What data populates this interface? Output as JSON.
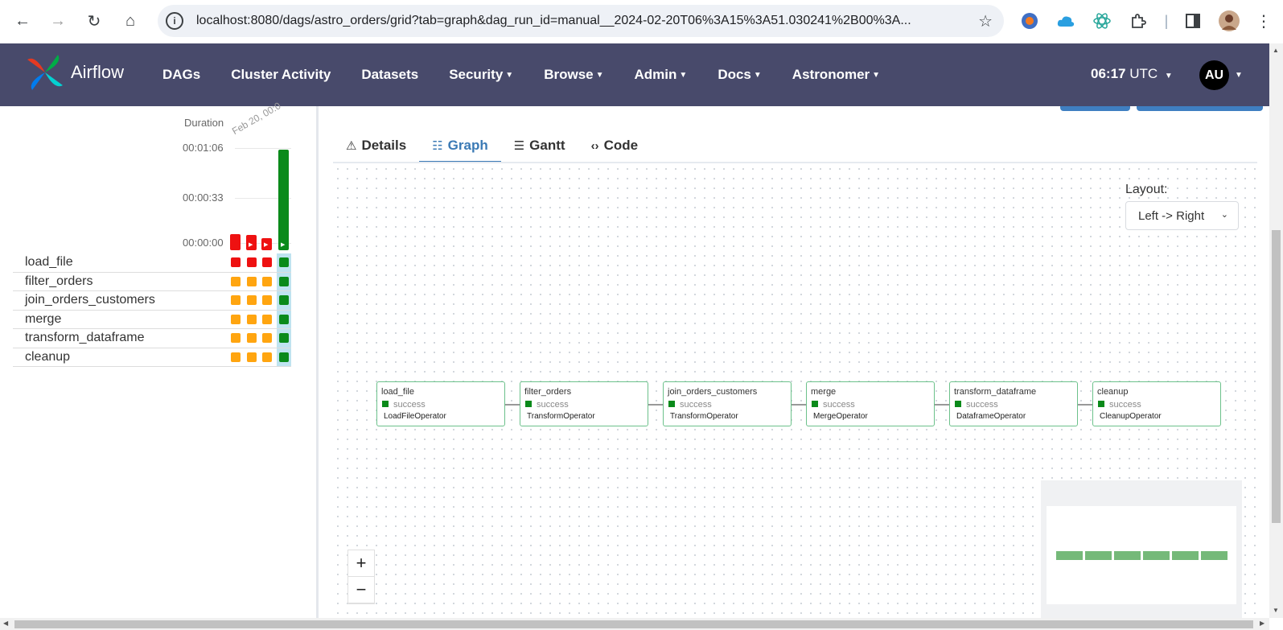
{
  "browser": {
    "url": "localhost:8080/dags/astro_orders/grid?tab=graph&dag_run_id=manual__2024-02-20T06%3A15%3A51.030241%2B00%3A..."
  },
  "navbar": {
    "brand": "Airflow",
    "menu": [
      {
        "label": "DAGs",
        "dropdown": false
      },
      {
        "label": "Cluster Activity",
        "dropdown": false
      },
      {
        "label": "Datasets",
        "dropdown": false
      },
      {
        "label": "Security",
        "dropdown": true
      },
      {
        "label": "Browse",
        "dropdown": true
      },
      {
        "label": "Admin",
        "dropdown": true
      },
      {
        "label": "Docs",
        "dropdown": true
      },
      {
        "label": "Astronomer",
        "dropdown": true
      }
    ],
    "time": "06:17",
    "timezone": "UTC",
    "avatar_initials": "AU"
  },
  "grid": {
    "duration_label": "Duration",
    "date_label": "Feb 20, 00:0",
    "ticks": [
      "00:01:06",
      "00:00:33",
      "00:00:00"
    ],
    "runs": [
      {
        "state": "failed",
        "color": "#ee1111",
        "duration_fraction": 0.16
      },
      {
        "state": "failed",
        "color": "#ee1111",
        "duration_fraction": 0.15
      },
      {
        "state": "failed",
        "color": "#ee1111",
        "duration_fraction": 0.12
      },
      {
        "state": "success",
        "color": "#0a8a1a",
        "duration_fraction": 1.0
      }
    ],
    "tasks": [
      {
        "name": "load_file",
        "states": [
          "#ee1111",
          "#ee1111",
          "#ee1111",
          "#0a8a1a"
        ]
      },
      {
        "name": "filter_orders",
        "states": [
          "#ffa510",
          "#ffa510",
          "#ffa510",
          "#0a8a1a"
        ]
      },
      {
        "name": "join_orders_customers",
        "states": [
          "#ffa510",
          "#ffa510",
          "#ffa510",
          "#0a8a1a"
        ]
      },
      {
        "name": "merge",
        "states": [
          "#ffa510",
          "#ffa510",
          "#ffa510",
          "#0a8a1a"
        ]
      },
      {
        "name": "transform_dataframe",
        "states": [
          "#ffa510",
          "#ffa510",
          "#ffa510",
          "#0a8a1a"
        ]
      },
      {
        "name": "cleanup",
        "states": [
          "#ffa510",
          "#ffa510",
          "#ffa510",
          "#0a8a1a"
        ]
      }
    ]
  },
  "tabs": [
    {
      "label": "Details",
      "icon": "warning-icon",
      "active": false
    },
    {
      "label": "Graph",
      "icon": "graph-icon",
      "active": true
    },
    {
      "label": "Gantt",
      "icon": "gantt-icon",
      "active": false
    },
    {
      "label": "Code",
      "icon": "code-icon",
      "active": false
    }
  ],
  "graph": {
    "layout_label": "Layout:",
    "layout_value": "Left -> Right",
    "nodes": [
      {
        "id": "load_file",
        "state": "success",
        "operator": "LoadFileOperator"
      },
      {
        "id": "filter_orders",
        "state": "success",
        "operator": "TransformOperator"
      },
      {
        "id": "join_orders_customers",
        "state": "success",
        "operator": "TransformOperator"
      },
      {
        "id": "merge",
        "state": "success",
        "operator": "MergeOperator"
      },
      {
        "id": "transform_dataframe",
        "state": "success",
        "operator": "DataframeOperator"
      },
      {
        "id": "cleanup",
        "state": "success",
        "operator": "CleanupOperator"
      }
    ],
    "zoom_in": "+",
    "zoom_out": "−"
  },
  "colors": {
    "navbar": "#484a6b",
    "success": "#0a8a1a",
    "failed": "#ee1111",
    "upstream_failed": "#ffa510",
    "active_tab": "#3b7ab5"
  }
}
